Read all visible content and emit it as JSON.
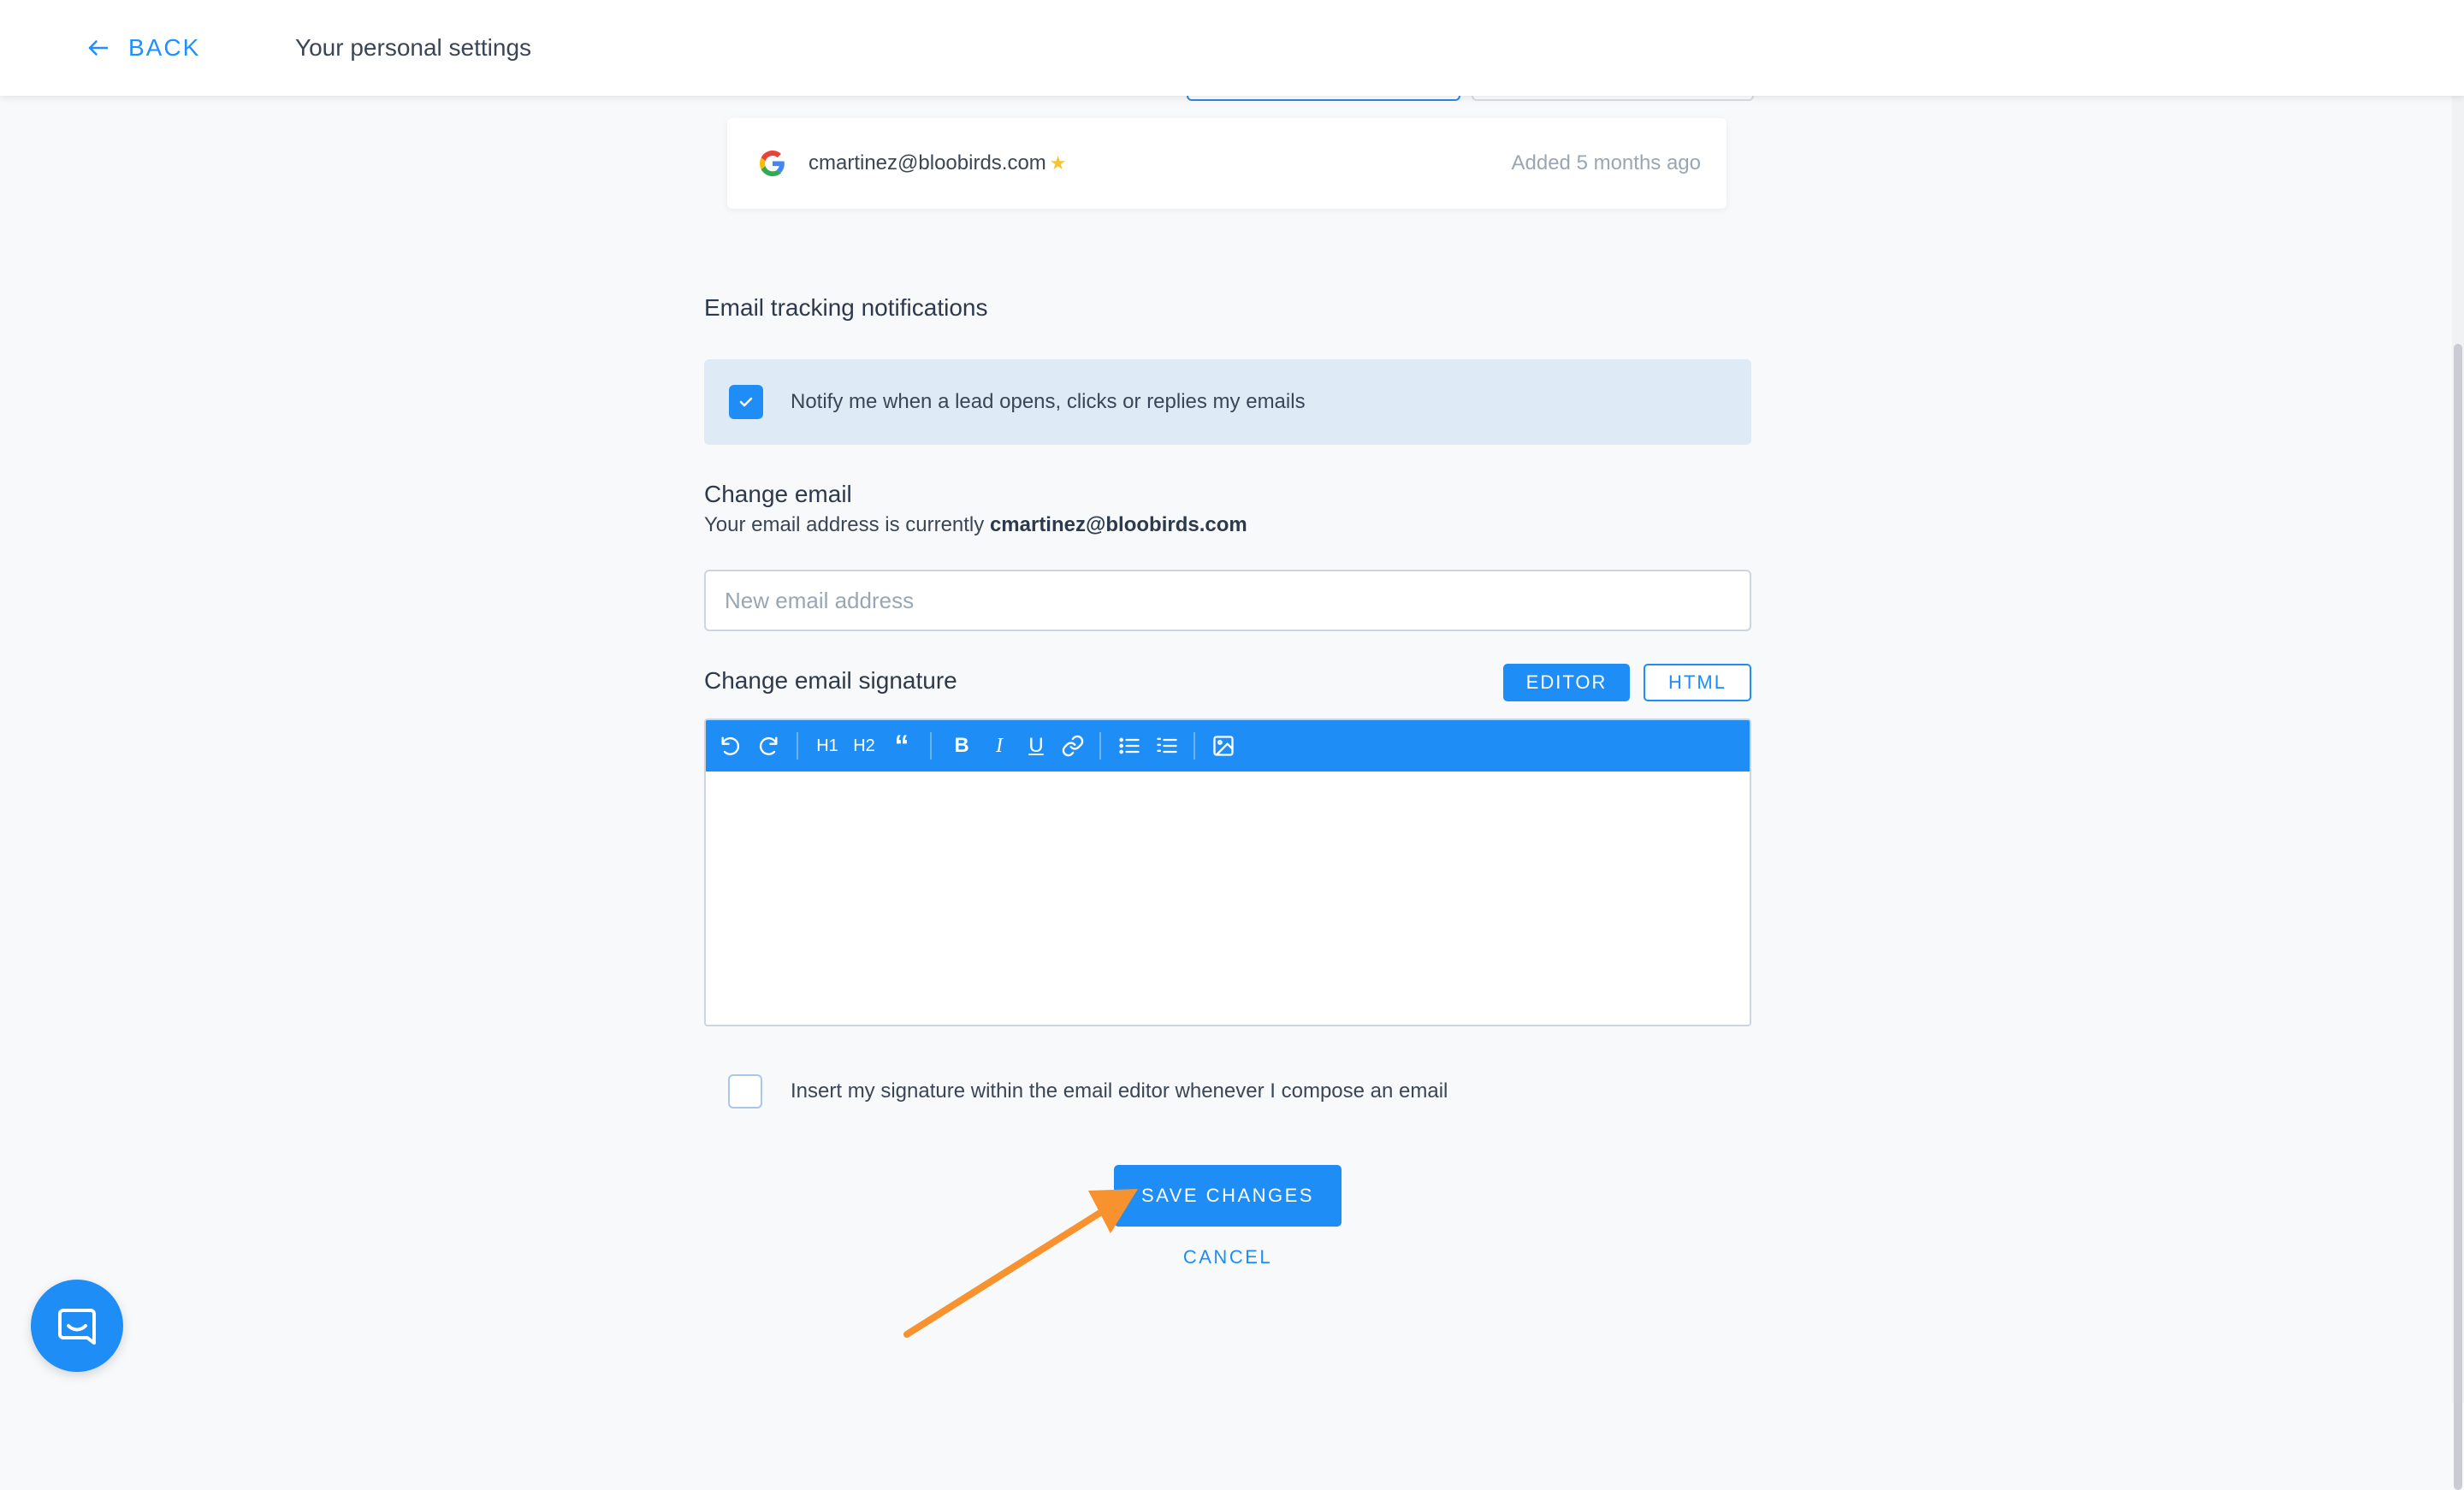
{
  "header": {
    "back_label": "BACK",
    "title": "Your personal settings"
  },
  "account": {
    "provider_icon": "google-icon",
    "email": "cmartinez@bloobirds.com",
    "added": "Added 5 months ago"
  },
  "tracking": {
    "title": "Email tracking notifications",
    "option_label": "Notify me when a lead opens, clicks or replies my emails",
    "checked": true
  },
  "change_email": {
    "title": "Change email",
    "current_prefix": "Your email address is currently",
    "current_email": "cmartinez@bloobirds.com",
    "placeholder": "New email address"
  },
  "signature": {
    "title": "Change email signature",
    "editor_label": "EDITOR",
    "html_label": "HTML",
    "toolbar": {
      "h1": "H1",
      "h2": "H2",
      "quote": "“",
      "bold": "B",
      "italic": "I",
      "underline": "U"
    },
    "insert_label": "Insert my signature within the email editor whenever I compose an email",
    "insert_checked": false
  },
  "actions": {
    "save_label": "SAVE CHANGES",
    "cancel_label": "CANCEL"
  },
  "colors": {
    "accent": "#1e8df5",
    "annotation_arrow": "#f7922f",
    "notify_bg": "#deebf7"
  }
}
